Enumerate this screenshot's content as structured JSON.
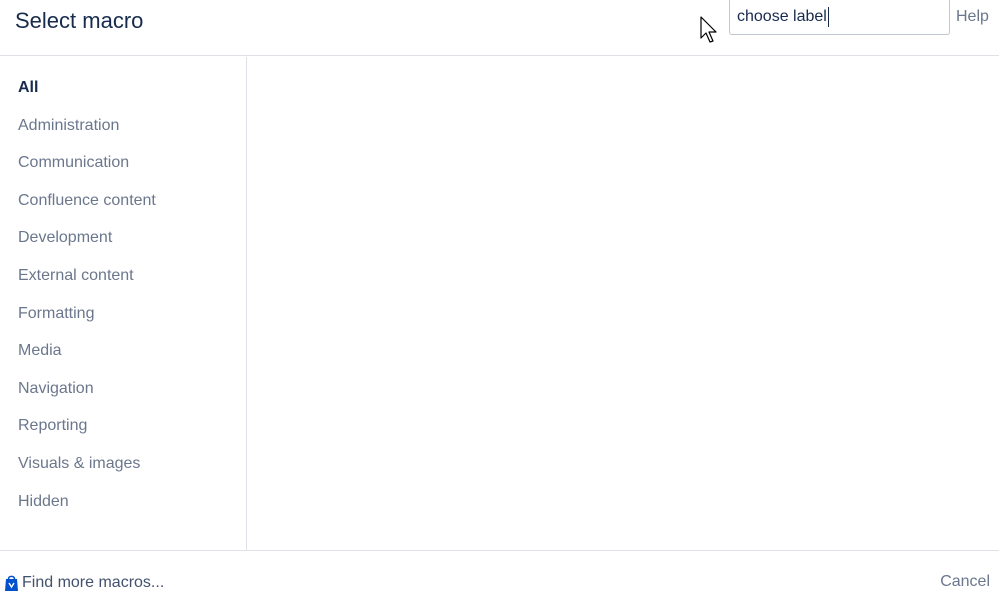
{
  "header": {
    "title": "Select macro",
    "search": {
      "value": "choose label",
      "placeholder": ""
    },
    "help_label": "Help"
  },
  "sidebar": {
    "items": [
      {
        "label": "All",
        "active": true
      },
      {
        "label": "Administration",
        "active": false
      },
      {
        "label": "Communication",
        "active": false
      },
      {
        "label": "Confluence content",
        "active": false
      },
      {
        "label": "Development",
        "active": false
      },
      {
        "label": "External content",
        "active": false
      },
      {
        "label": "Formatting",
        "active": false
      },
      {
        "label": "Media",
        "active": false
      },
      {
        "label": "Navigation",
        "active": false
      },
      {
        "label": "Reporting",
        "active": false
      },
      {
        "label": "Visuals & images",
        "active": false
      },
      {
        "label": "Hidden",
        "active": false
      }
    ]
  },
  "footer": {
    "find_more_label": "Find more macros...",
    "find_more_icon": "marketplace-bag-icon",
    "cancel_label": "Cancel"
  },
  "colors": {
    "primary_text": "#172b4d",
    "secondary_text": "#6b778c",
    "divider": "#dfe1e6",
    "marketplace_icon": "#0052cc"
  }
}
